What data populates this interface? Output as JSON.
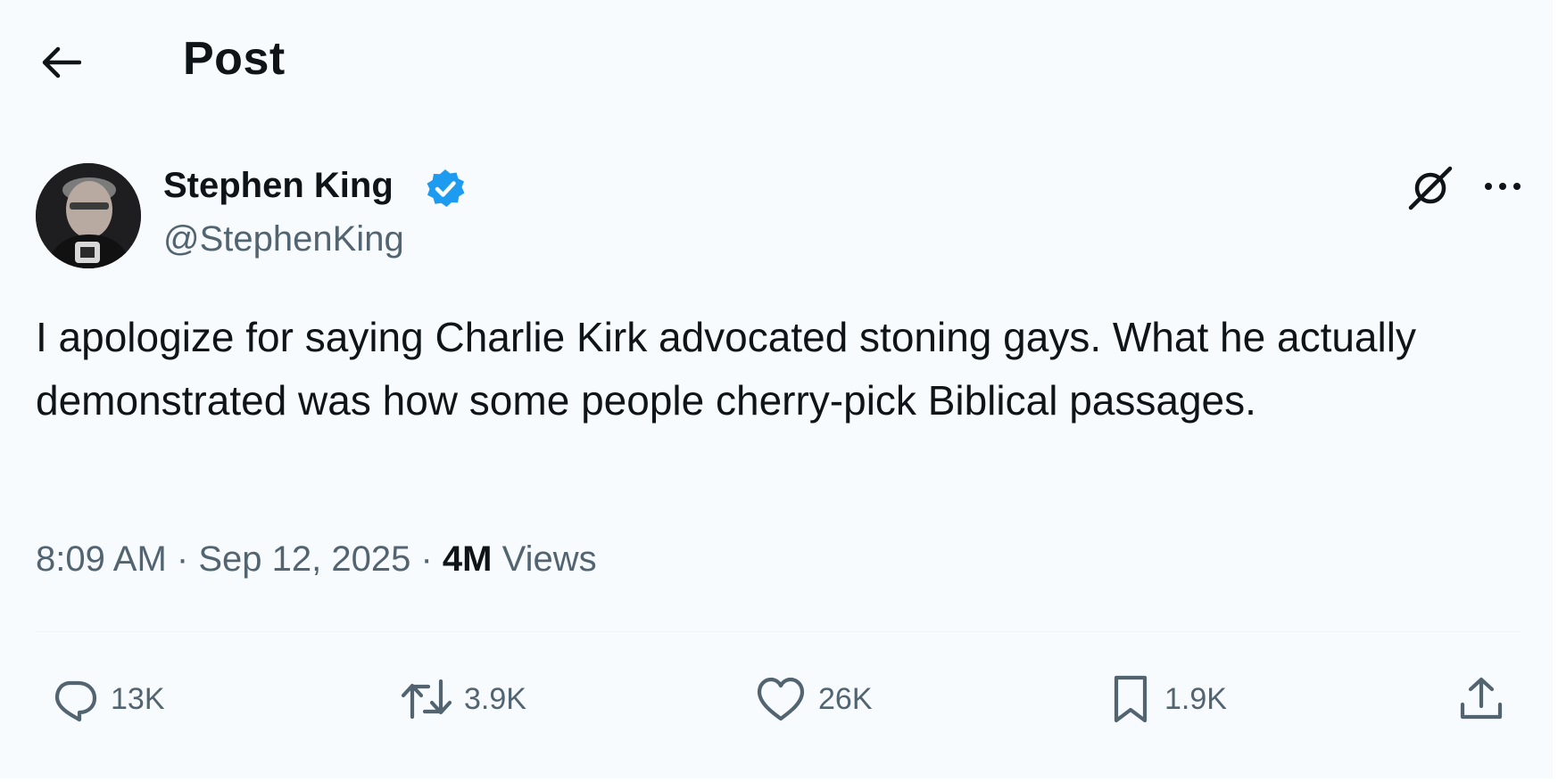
{
  "header": {
    "title": "Post",
    "back_icon": "arrow-left-icon"
  },
  "author": {
    "name": "Stephen King",
    "handle": "@StephenKing",
    "verified": true,
    "verified_color": "#1d9bf0"
  },
  "post": {
    "text": "I apologize for saying Charlie Kirk advocated stoning gays. What he actually demonstrated was how some people cherry-pick Biblical passages.",
    "time": "8:09 AM",
    "date": "Sep 12, 2025",
    "separator": "·",
    "views_count": "4M",
    "views_label": "Views"
  },
  "actions": {
    "replies": "13K",
    "reposts": "3.9K",
    "likes": "26K",
    "bookmarks": "1.9K"
  },
  "colors": {
    "text_primary": "#0f1419",
    "text_secondary": "#536471",
    "background": "#f7fbfe"
  }
}
